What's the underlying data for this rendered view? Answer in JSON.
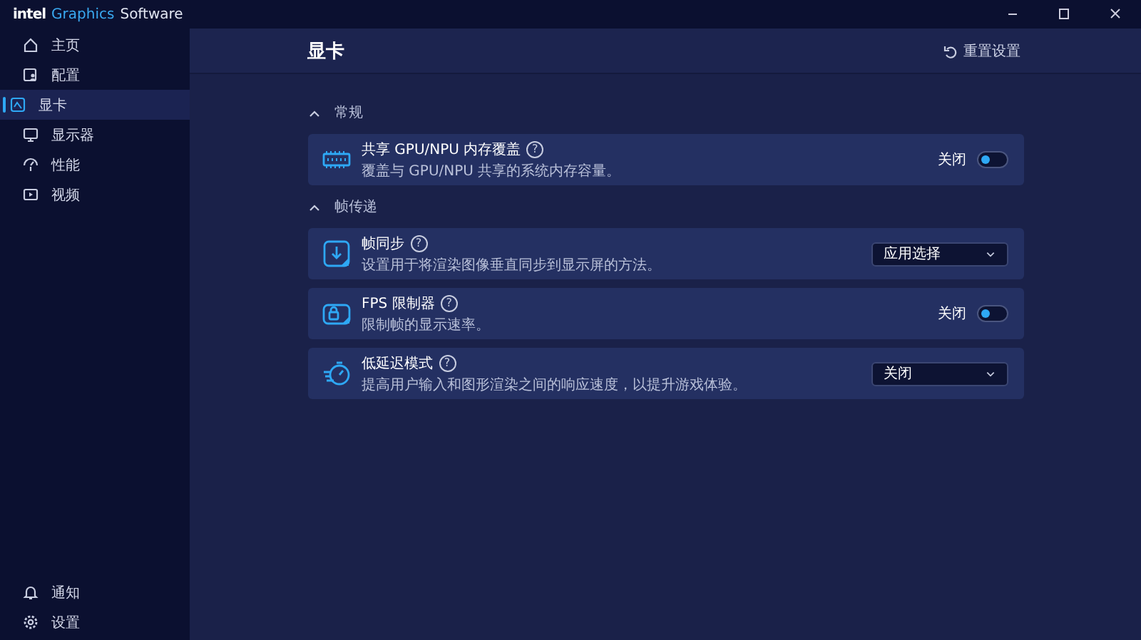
{
  "window": {
    "brand": "intel",
    "title_accent": "Graphics",
    "title_rest": "Software"
  },
  "sidebar": {
    "items": [
      {
        "label": "主页",
        "selected": false
      },
      {
        "label": "配置",
        "selected": false
      },
      {
        "label": "显卡",
        "selected": true
      },
      {
        "label": "显示器",
        "selected": false
      },
      {
        "label": "性能",
        "selected": false
      },
      {
        "label": "视频",
        "selected": false
      }
    ],
    "bottom_items": [
      {
        "label": "通知",
        "selected": false
      },
      {
        "label": "设置",
        "selected": false
      }
    ]
  },
  "page": {
    "title": "显卡",
    "reset": "重置设置"
  },
  "sections": [
    {
      "title": "常规",
      "expanded": true,
      "settings": [
        {
          "kind": "toggle",
          "title": "共享 GPU/NPU 内存覆盖",
          "help": "?",
          "description": "覆盖与 GPU/NPU 共享的系统内存容量。",
          "state_label": "关闭",
          "on": false
        }
      ]
    },
    {
      "title": "帧传递",
      "expanded": true,
      "settings": [
        {
          "kind": "dropdown",
          "title": "帧同步",
          "help": "?",
          "description": "设置用于将渲染图像垂直同步到显示屏的方法。",
          "value": "应用选择"
        },
        {
          "kind": "toggle",
          "title": "FPS 限制器",
          "help": "?",
          "description": "限制帧的显示速率。",
          "state_label": "关闭",
          "on": false
        },
        {
          "kind": "dropdown",
          "title": "低延迟模式",
          "help": "?",
          "description": "提高用户输入和图形渲染之间的响应速度，以提升游戏体验。",
          "value": "关闭"
        }
      ]
    }
  ]
}
